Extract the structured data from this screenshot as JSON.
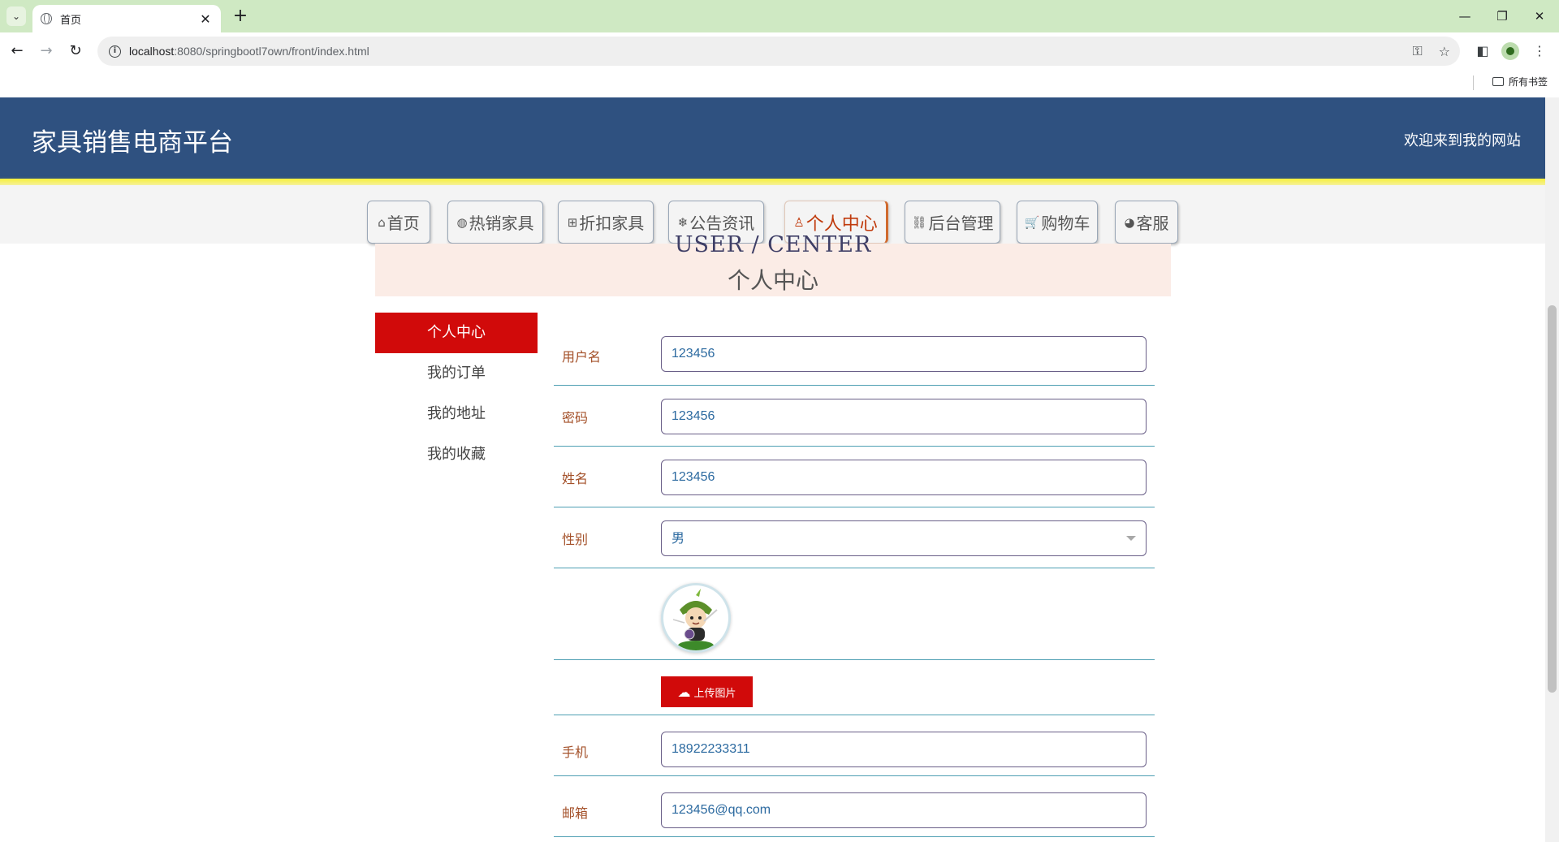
{
  "browser": {
    "tab_title": "首页",
    "url_host": "localhost",
    "url_path": ":8080/springbootl7own/front/index.html",
    "bookmarks_label": "所有书签"
  },
  "header": {
    "title": "家具销售电商平台",
    "welcome": "欢迎来到我的网站"
  },
  "nav": {
    "items": [
      {
        "icon": "⌂",
        "label": "首页"
      },
      {
        "icon": "◍",
        "label": "热销家具"
      },
      {
        "icon": "⊞",
        "label": "折扣家具"
      },
      {
        "icon": "❄",
        "label": "公告资讯"
      },
      {
        "icon": "♙",
        "label": "个人中心"
      },
      {
        "icon": "⛓",
        "label": "后台管理"
      },
      {
        "icon": "🛒",
        "label": "购物车"
      },
      {
        "icon": "◕",
        "label": "客服"
      }
    ],
    "active_index": 4,
    "active_color": "#c03a0c"
  },
  "banner": {
    "en": "USER / CENTER",
    "cn": "个人中心"
  },
  "sidebar": {
    "items": [
      "个人中心",
      "我的订单",
      "我的地址",
      "我的收藏"
    ],
    "active_color": "#d10a0a"
  },
  "form": {
    "username_label": "用户名",
    "username_value": "123456",
    "password_label": "密码",
    "password_value": "123456",
    "name_label": "姓名",
    "name_value": "123456",
    "gender_label": "性别",
    "gender_value": "男",
    "upload_label": "上传图片",
    "phone_label": "手机",
    "phone_value": "18922233311",
    "email_label": "邮箱",
    "email_value": "123456@qq.com"
  },
  "colors": {
    "header_bg": "#2f5180",
    "accent_red": "#d10a0a",
    "row_line": "#4e9fb3",
    "label": "#a4512a"
  }
}
